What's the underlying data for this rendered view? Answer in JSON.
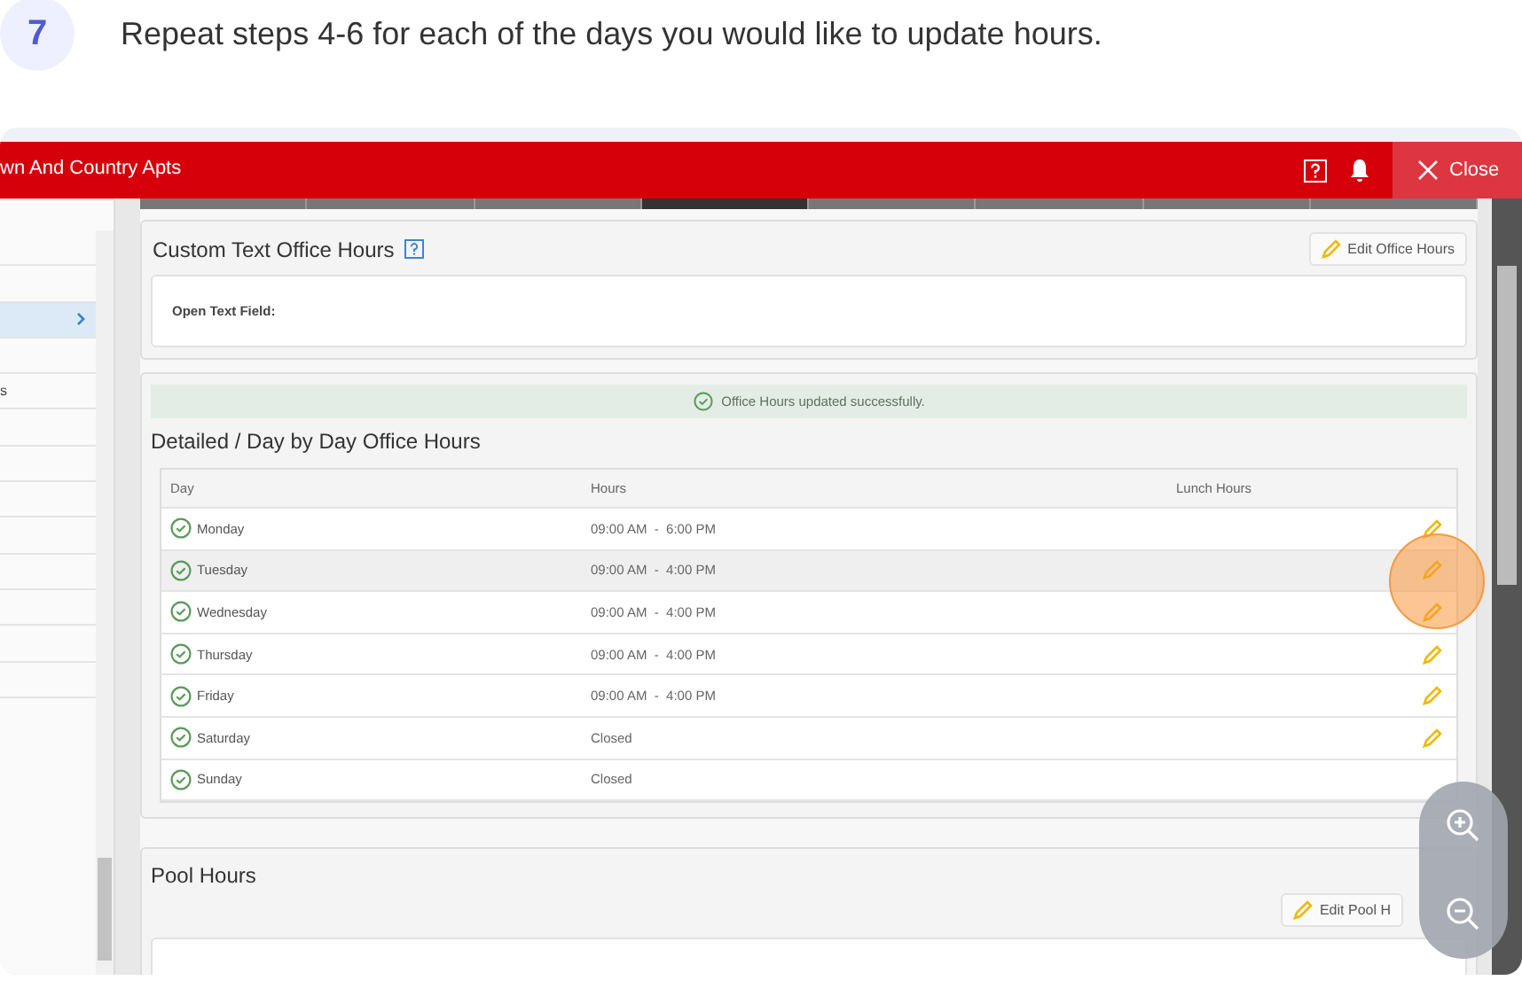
{
  "step": {
    "number": "7",
    "text": "Repeat steps 4-6 for each of the days you would like to update hours."
  },
  "header": {
    "title": "wn And Country Apts",
    "close": "Close"
  },
  "sidebar": {
    "items": [
      {
        "selected": false
      },
      {
        "selected": false
      },
      {
        "selected": true
      },
      {
        "selected": false
      },
      {
        "label": "s",
        "selected": false
      },
      {
        "selected": false
      },
      {
        "selected": false
      },
      {
        "selected": false
      },
      {
        "selected": false
      },
      {
        "selected": false
      },
      {
        "selected": false
      },
      {
        "selected": false
      },
      {
        "selected": false
      }
    ]
  },
  "tabs": [
    {
      "selected": false
    },
    {
      "selected": false
    },
    {
      "selected": false
    },
    {
      "selected": true
    },
    {
      "selected": false
    },
    {
      "selected": false
    },
    {
      "selected": false
    },
    {
      "selected": false
    }
  ],
  "custom_text": {
    "title": "Custom Text Office Hours",
    "edit_button": "Edit Office Hours",
    "field_label": "Open Text Field:"
  },
  "detailed": {
    "alert": "Office Hours updated successfully.",
    "title": "Detailed / Day by Day Office Hours",
    "columns": [
      "Day",
      "Hours",
      "Lunch Hours"
    ],
    "rows": [
      {
        "day": "Monday",
        "hours": "09:00 AM  -  6:00 PM",
        "selected": false,
        "editable": true
      },
      {
        "day": "Tuesday",
        "hours": "09:00 AM  -  4:00 PM",
        "selected": true,
        "editable": true
      },
      {
        "day": "Wednesday",
        "hours": "09:00 AM  -  4:00 PM",
        "selected": false,
        "editable": true
      },
      {
        "day": "Thursday",
        "hours": "09:00 AM  -  4:00 PM",
        "selected": false,
        "editable": true
      },
      {
        "day": "Friday",
        "hours": "09:00 AM  -  4:00 PM",
        "selected": false,
        "editable": true
      },
      {
        "day": "Saturday",
        "hours": "Closed",
        "selected": false,
        "editable": true
      },
      {
        "day": "Sunday",
        "hours": "Closed",
        "selected": false,
        "editable": false
      }
    ]
  },
  "pool": {
    "title": "Pool Hours",
    "edit_button": "Edit Pool H"
  }
}
